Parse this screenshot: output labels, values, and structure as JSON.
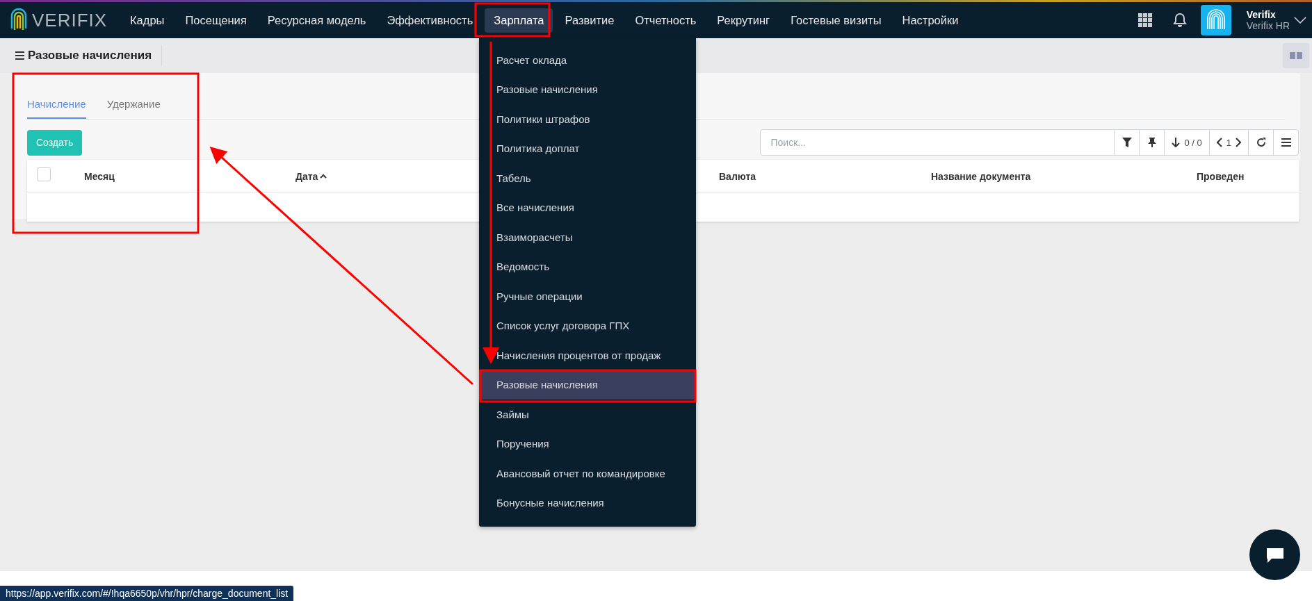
{
  "logo": {
    "text": "VERIFIX"
  },
  "nav": [
    {
      "label": "Кадры",
      "selected": false
    },
    {
      "label": "Посещения",
      "selected": false
    },
    {
      "label": "Ресурсная модель",
      "selected": false
    },
    {
      "label": "Эффективность",
      "selected": false
    },
    {
      "label": "Зарплата",
      "selected": true
    },
    {
      "label": "Развитие",
      "selected": false
    },
    {
      "label": "Отчетность",
      "selected": false
    },
    {
      "label": "Рекрутинг",
      "selected": false
    },
    {
      "label": "Гостевые визиты",
      "selected": false
    },
    {
      "label": "Настройки",
      "selected": false
    }
  ],
  "user": {
    "name": "Verifix",
    "company": "Verifix HR"
  },
  "page_title": "Разовые начисления",
  "tabs": [
    {
      "label": "Начисление",
      "selected": true
    },
    {
      "label": "Удержание",
      "selected": false
    }
  ],
  "create_button": "Создать",
  "search": {
    "placeholder": "Поиск..."
  },
  "pager": {
    "count": "0 / 0",
    "page": "1"
  },
  "table": {
    "select_all": {
      "checked": false
    },
    "columns": [
      {
        "label": "Месяц",
        "sorted": false
      },
      {
        "label": "Дата",
        "sorted": true
      },
      {
        "label": "Валюта",
        "sorted": false
      },
      {
        "label": "Название документа",
        "sorted": false
      },
      {
        "label": "Проведен",
        "sorted": false
      }
    ]
  },
  "dropdown": [
    {
      "label": "Расчет оклада",
      "selected": false
    },
    {
      "label": "Разовые начисления",
      "selected": false
    },
    {
      "label": "Политики штрафов",
      "selected": false
    },
    {
      "label": "Политика доплат",
      "selected": false
    },
    {
      "label": "Табель",
      "selected": false
    },
    {
      "label": "Все начисления",
      "selected": false
    },
    {
      "label": "Взаиморасчеты",
      "selected": false
    },
    {
      "label": "Ведомость",
      "selected": false
    },
    {
      "label": "Ручные операции",
      "selected": false
    },
    {
      "label": "Список услуг договора ГПХ",
      "selected": false
    },
    {
      "label": "Начисления процентов от продаж",
      "selected": false
    },
    {
      "label": "Разовые начисления",
      "selected": true
    },
    {
      "label": "Займы",
      "selected": false
    },
    {
      "label": "Поручения",
      "selected": false
    },
    {
      "label": "Авансовый отчет по командировке",
      "selected": false
    },
    {
      "label": "Бонусные начисления",
      "selected": false
    }
  ],
  "status_url": "https://app.verifix.com/#/!hqa6650p/vhr/hpr/charge_document_list"
}
